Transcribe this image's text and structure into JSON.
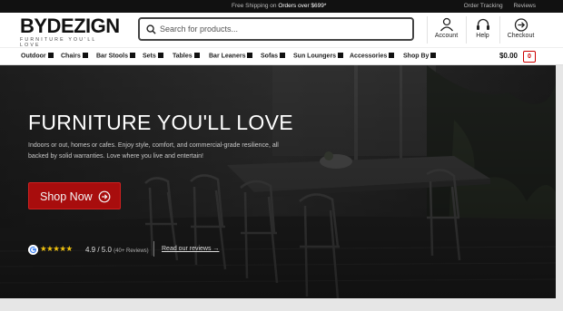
{
  "topbar": {
    "shipping_prefix": "Free Shipping on ",
    "shipping_highlight": "Orders over $699*",
    "links": [
      "Order Tracking",
      "Reviews"
    ]
  },
  "header": {
    "logo_text": "BYDEZIGN",
    "logo_tagline": "FURNITURE YOU'LL LOVE",
    "search": {
      "placeholder": "Search for products..."
    },
    "buttons": {
      "account": "Account",
      "help": "Help",
      "checkout": "Checkout"
    }
  },
  "nav": {
    "items": [
      "Outdoor",
      "Chairs",
      "Bar Stools",
      "Sets",
      "Tables",
      "Bar Leaners",
      "Sofas",
      "Sun Loungers",
      "Accessories",
      "Shop By"
    ],
    "cart_total": "$0.00",
    "cart_count": "0"
  },
  "hero": {
    "title": "FURNITURE YOU'LL LOVE",
    "subtitle": "Indoors or out, homes or cafes. Enjoy style, comfort, and commercial-grade resilience, all backed by solid warranties. Love where you live and entertain!",
    "cta": "Shop Now"
  },
  "rating": {
    "stars": "★★★★★",
    "score": "4.9 / 5.0",
    "count": "(40+ Reviews)",
    "link": "Read our reviews →"
  },
  "colors": {
    "accent": "#a80d0d",
    "star": "#f2c40f",
    "topbar": "#111111"
  }
}
